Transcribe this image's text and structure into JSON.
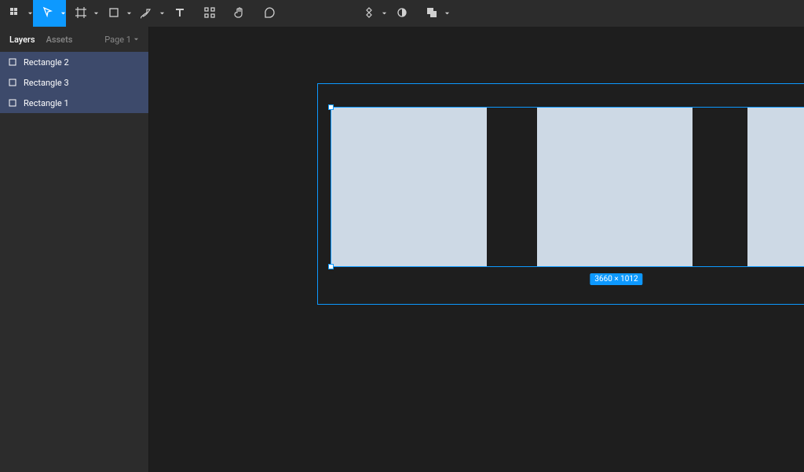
{
  "toolbar": {
    "left_tools": [
      "menu",
      "move",
      "frame",
      "shape",
      "pen",
      "text",
      "resources",
      "hand",
      "comment"
    ],
    "center_tools": [
      "component",
      "mask",
      "boolean"
    ]
  },
  "sidebar": {
    "tabs": {
      "layers": "Layers",
      "assets": "Assets"
    },
    "page_label": "Page 1",
    "layers": [
      {
        "name": "Rectangle 2"
      },
      {
        "name": "Rectangle 3"
      },
      {
        "name": "Rectangle 1"
      }
    ]
  },
  "canvas": {
    "selection_dimensions": "3660 × 1012"
  }
}
